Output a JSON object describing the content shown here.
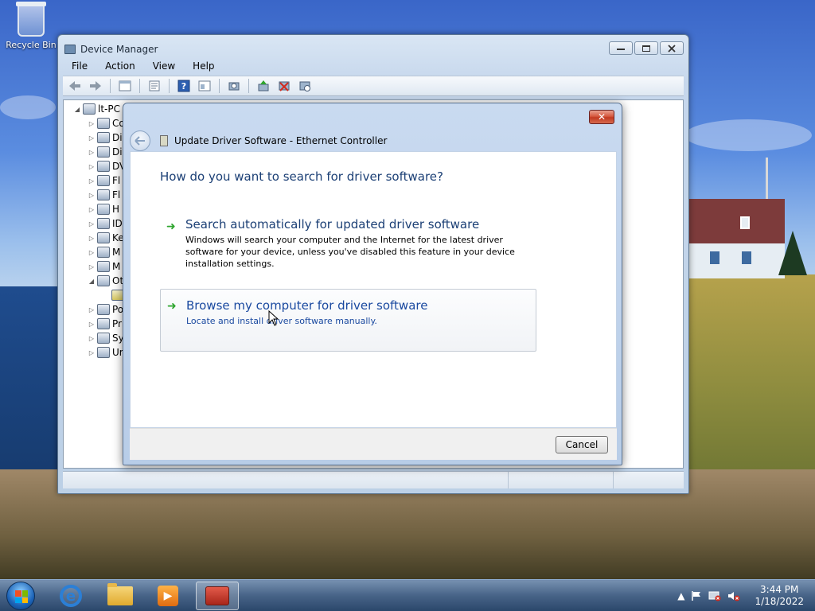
{
  "desktop": {
    "recycle_bin_label": "Recycle Bin"
  },
  "device_manager": {
    "title": "Device Manager",
    "menu": [
      "File",
      "Action",
      "View",
      "Help"
    ],
    "toolbar_icons": [
      "back-icon",
      "forward-icon",
      "properties-icon",
      "show-hidden-icon",
      "help-icon",
      "view-icon",
      "scan-icon",
      "update-driver-icon",
      "disable-icon",
      "uninstall-icon"
    ],
    "tree": {
      "root": "lt-PC",
      "items": [
        {
          "label": "Co",
          "icon": "computer-icon",
          "expanded": false
        },
        {
          "label": "Di",
          "icon": "disk-drive-icon",
          "expanded": false
        },
        {
          "label": "Di",
          "icon": "display-adapter-icon",
          "expanded": false
        },
        {
          "label": "DV",
          "icon": "dvd-drive-icon",
          "expanded": false
        },
        {
          "label": "Fl",
          "icon": "floppy-drive-icon",
          "expanded": false
        },
        {
          "label": "Fl",
          "icon": "floppy-controller-icon",
          "expanded": false
        },
        {
          "label": "H",
          "icon": "hid-icon",
          "expanded": false
        },
        {
          "label": "ID",
          "icon": "ide-controller-icon",
          "expanded": false
        },
        {
          "label": "Ke",
          "icon": "keyboard-icon",
          "expanded": false
        },
        {
          "label": "M",
          "icon": "mouse-icon",
          "expanded": false
        },
        {
          "label": "M",
          "icon": "monitor-icon",
          "expanded": false
        },
        {
          "label": "Ot",
          "icon": "other-devices-icon",
          "expanded": true
        },
        {
          "label": "",
          "icon": "unknown-device-icon",
          "expanded": false,
          "child": true
        },
        {
          "label": "Po",
          "icon": "ports-icon",
          "expanded": false
        },
        {
          "label": "Pr",
          "icon": "processor-icon",
          "expanded": false
        },
        {
          "label": "Sy",
          "icon": "system-devices-icon",
          "expanded": false
        },
        {
          "label": "Ur",
          "icon": "usb-icon",
          "expanded": false
        }
      ]
    }
  },
  "dialog": {
    "title": "Update Driver Software - Ethernet Controller",
    "close_label": "✕",
    "question": "How do you want to search for driver software?",
    "options": [
      {
        "title": "Search automatically for updated driver software",
        "description": "Windows will search your computer and the Internet for the latest driver software for your device, unless you've disabled this feature in your device installation settings."
      },
      {
        "title": "Browse my computer for driver software",
        "description": "Locate and install driver software manually."
      }
    ],
    "cancel_label": "Cancel"
  },
  "taskbar": {
    "apps": [
      "internet-explorer-icon",
      "windows-explorer-icon",
      "media-player-icon",
      "device-manager-icon"
    ],
    "clock_time": "3:44 PM",
    "clock_date": "1/18/2022"
  }
}
